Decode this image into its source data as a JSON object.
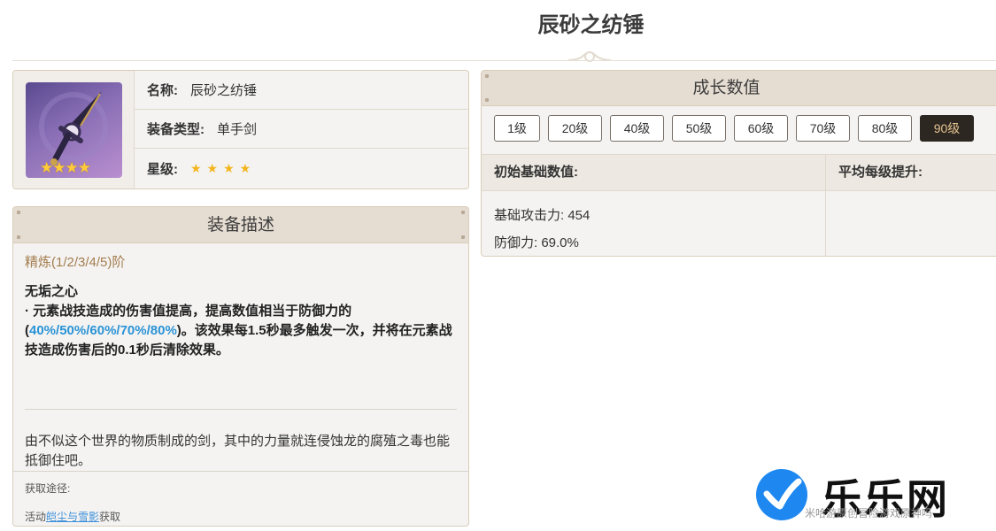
{
  "page": {
    "title": "辰砂之纺锤"
  },
  "info": {
    "name_key": "名称:",
    "name_val": "辰砂之纺锤",
    "type_key": "装备类型:",
    "type_val": "单手剑",
    "rarity_key": "星级:",
    "rarity_stars": "★★★★",
    "thumb_stars": "★★★★"
  },
  "description": {
    "header": "装备描述",
    "refine": "精炼(1/2/3/4/5)阶",
    "passive_name": "无垢之心",
    "passive_pre": "· 元素战技造成的伤害值提高，提高数值相当于防御力的(",
    "passive_highlight": "40%/50%/60%/70%/80%",
    "passive_post": ")。该效果每1.5秒最多触发一次，并将在元素战技造成伤害后的0.1秒后清除效果。",
    "lore": "由不似这个世界的物质制成的剑，其中的力量就连侵蚀龙的腐殖之毒也能抵御住吧。",
    "source_label": "获取途径:",
    "source_pre": "活动",
    "source_link": "皑尘与雪影",
    "source_post": "获取"
  },
  "growth": {
    "header": "成长数值",
    "levels": [
      "1级",
      "20级",
      "40级",
      "50级",
      "60级",
      "70级",
      "80级",
      "90级"
    ],
    "active_level": "90级",
    "col_base": "初始基础数值:",
    "col_avg": "平均每级提升:",
    "stat_atk": "基础攻击力: 454",
    "stat_def": "防御力: 69.0%"
  },
  "watermark": {
    "brand": "乐乐网",
    "small": "米哈游原创冒险游戏原神吗"
  },
  "colors": {
    "accent_blue": "#2b93d6",
    "refine_gold": "#a47d4e",
    "active_btn_bg": "#2d2722",
    "active_btn_text": "#e3c38f",
    "star_gold": "#f3b51c"
  }
}
